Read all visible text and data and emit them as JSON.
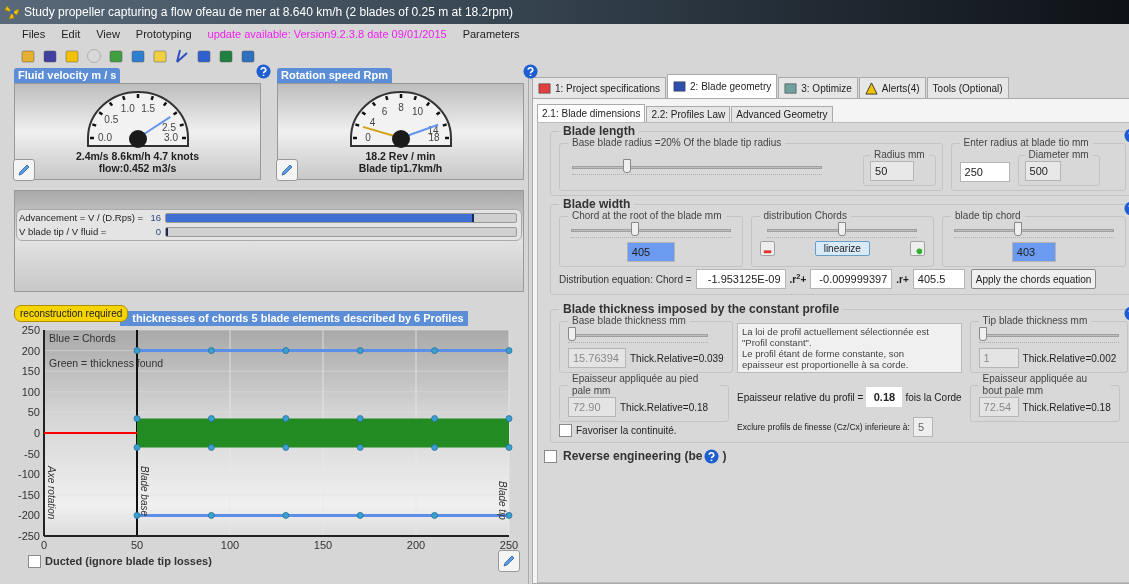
{
  "window": {
    "title": "Study propeller capturing a flow ofeau de mer at 8.640 km/h (2 blades of 0.25 m at 18.2rpm)"
  },
  "menu": [
    {
      "label": "Files",
      "kind": "item"
    },
    {
      "label": "Edit",
      "kind": "item"
    },
    {
      "label": "View",
      "kind": "item"
    },
    {
      "label": "Prototyping",
      "kind": "item"
    },
    {
      "label": "update available: Version9.2.3.8 date 09/01/2015",
      "kind": "notice"
    },
    {
      "label": "Parameters",
      "kind": "item"
    }
  ],
  "gauges": [
    {
      "title": "Fluid velocity m / s",
      "ticks": [
        "0.0",
        "0.5",
        "1.0",
        "1.5",
        "2.5",
        "3.0"
      ],
      "readout": [
        "2.4m/s 8.6km/h 4.7 knots",
        "flow:0.452 m3/s"
      ]
    },
    {
      "title": "Rotation speed Rpm",
      "ticks": [
        "0",
        "4",
        "6",
        "8",
        "10",
        "14",
        "18"
      ],
      "readout": [
        "18.2 Rev / min",
        "Blade tip1.7km/h"
      ]
    }
  ],
  "ratios": [
    {
      "label": "Advancement = V / (D.Rps) =",
      "value": "16",
      "level": 0.88
    },
    {
      "label": "V blade tip / V fluid =",
      "value": "0",
      "level": 0.005
    }
  ],
  "chart_panel": {
    "badge": "reconstruction required",
    "title": "thicknesses of chords 5  blade elements described by  6 Profiles",
    "legend": [
      "Blue = Chords",
      "Green = thickness found"
    ],
    "markers": [
      "Axe rotation",
      "Blade base",
      "Blade tip"
    ],
    "chart_data": {
      "type": "line",
      "x": [
        0,
        50,
        90,
        130,
        170,
        210,
        250
      ],
      "xlim": [
        0,
        250
      ],
      "ylim": [
        -250,
        250
      ],
      "xticks": [
        0,
        50,
        100,
        150,
        200,
        250
      ],
      "yticks": [
        -250,
        -200,
        -150,
        -100,
        -50,
        0,
        50,
        100,
        150,
        200,
        250
      ],
      "grid": true,
      "ref_lines": [
        {
          "axis": "x",
          "value": 50,
          "color": "#111111"
        }
      ],
      "series": [
        {
          "color": "#5b8fe8",
          "marker": "o",
          "values": [
            null,
            200,
            200,
            200,
            200,
            200,
            200
          ]
        },
        {
          "color": "#5b8fe8",
          "marker": "o",
          "values": [
            null,
            -200,
            -200,
            -200,
            -200,
            -200,
            -200
          ]
        },
        {
          "color": "#228b22",
          "type": "area",
          "marker": "o",
          "values": [
            null,
            35,
            35,
            35,
            35,
            35,
            35
          ]
        },
        {
          "color": "#228b22",
          "type": "area",
          "marker": "o",
          "values": [
            null,
            -35,
            -35,
            -35,
            -35,
            -35,
            -35
          ]
        },
        {
          "color": "#ff0000",
          "values": [
            0,
            0,
            null,
            null,
            null,
            null,
            null
          ]
        }
      ]
    }
  },
  "ducted": {
    "label": "Ducted (ignore blade tip losses)",
    "checked": false
  },
  "tabs": [
    {
      "label": "1: Project specifications",
      "selected": false
    },
    {
      "label": "2: Blade geometry",
      "selected": true
    },
    {
      "label": "3: Optimize",
      "selected": false
    },
    {
      "label": "Alerts(4)",
      "selected": false
    },
    {
      "label": "Tools (Optional)",
      "selected": false
    }
  ],
  "subtabs": [
    {
      "label": "2.1: Blade dimensions",
      "selected": true
    },
    {
      "label": "2.2: Profiles Law",
      "selected": false
    },
    {
      "label": "Advanced Geometry",
      "selected": false
    }
  ],
  "blade_length": {
    "title": "Blade length",
    "base": {
      "label": "Base blade radius =20% Of the blade tip radius",
      "level": 0.22,
      "radius_label": "Radius mm",
      "radius": "50"
    },
    "tip": {
      "label": "Enter radius at blade tio mm",
      "value": "250",
      "diameter_label": "Diameter  mm",
      "diameter": "500"
    }
  },
  "blade_width": {
    "title": "Blade width",
    "root": {
      "label": "Chord at the root of the blade mm",
      "level": 0.4,
      "value": "405"
    },
    "distribution": {
      "label": "distribution Chords",
      "level": 0.5,
      "button": "linearize"
    },
    "tip": {
      "label": "blade tip chord",
      "level": 0.4,
      "value": "403"
    },
    "equation": {
      "label": "Distribution equation: Chord =",
      "a": "-1.953125E-09",
      "a_suffix": ".r$^{2}$+",
      "b": "-0.009999397",
      "b_suffix": ".r+",
      "c": "405.5",
      "button": "Apply the chords equation"
    }
  },
  "blade_thickness": {
    "title": "Blade thickness imposed  by the constant profile",
    "base": {
      "label": "Base blade thickness mm",
      "level": 0.03,
      "value": "15.76394",
      "disabled": true,
      "relative": "Thick.Relative=0.039"
    },
    "note": "La loi de profil actuellement sélectionnée est\n\"Profil constant\".\nLe profil étant de forme constante, son\nepaisseur est proportionelle à  sa corde.",
    "tip": {
      "label": "Tip blade thickness mm",
      "level": 0.03,
      "value": "1",
      "disabled": true,
      "relative": "Thick.Relative=0.002"
    },
    "base_applied": {
      "label": "Epaisseur appliquée au pied pale mm",
      "value": "72.90",
      "disabled": true,
      "relative": "Thick.Relative=0.18"
    },
    "relative": {
      "label": "Epaisseur relative du profil =",
      "value": "0.18",
      "suffix": "fois la Corde"
    },
    "tip_applied": {
      "label": "Epaisseur appliquée au bout pale mm",
      "value": "72.54",
      "disabled": true,
      "relative": "Thick.Relative=0.18"
    },
    "continuity": {
      "label": "Favoriser la continuité.",
      "checked": false
    },
    "exclude": {
      "label": "Exclure profils de finesse (Cz/Cx) inferieure à:",
      "value": "5"
    }
  },
  "reverse": {
    "label": "Reverse engineering (be",
    "suffix": ")",
    "checked": false
  }
}
